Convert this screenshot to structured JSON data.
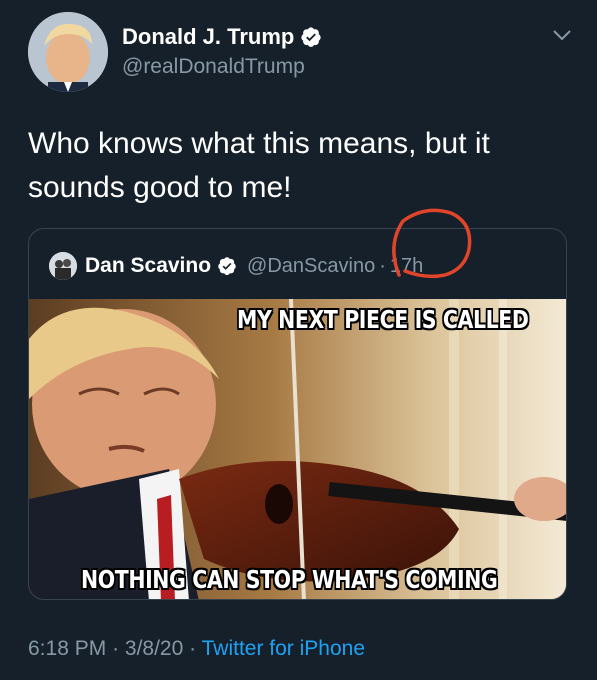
{
  "author": {
    "name": "Donald J. Trump",
    "handle": "@realDonaldTrump",
    "verified": true
  },
  "tweet": {
    "text": "Who knows what this means, but it sounds good to me!"
  },
  "quoted_tweet": {
    "name": "Dan Scavino",
    "handle": "@DanScavino",
    "separator": "·",
    "time": "17h",
    "verified": true,
    "image": {
      "top_caption": "MY NEXT PIECE IS CALLED",
      "bottom_caption": "NOTHING CAN STOP WHAT'S COMING"
    }
  },
  "footer": {
    "time": "6:18 PM",
    "sep1": "·",
    "date": "3/8/20",
    "sep2": "·",
    "source": "Twitter for iPhone"
  },
  "colors": {
    "background": "#15202b",
    "secondary_text": "#8899a6",
    "link": "#1da1f2",
    "verified_badge": "#ffffff",
    "annotation_circle": "#e0452a"
  },
  "icons": {
    "verified": "verified-badge-icon",
    "more": "chevron-down-icon"
  }
}
